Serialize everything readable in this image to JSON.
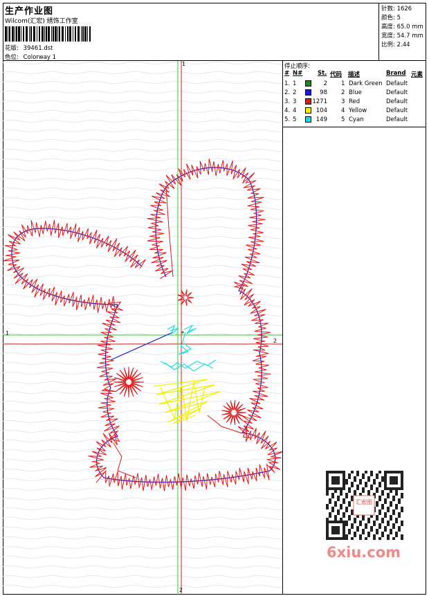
{
  "header": {
    "title": "生产作业图",
    "company": "Wilcom(汇宏) 绣饰工作室",
    "design_label": "花版:",
    "design_value": "39461.dst",
    "colorway_label": "色位:",
    "colorway_value": "Colorway 1"
  },
  "stats": [
    {
      "label": "针数:",
      "value": "1626"
    },
    {
      "label": "颜色:",
      "value": "5"
    },
    {
      "label": "高度:",
      "value": "65.0 mm"
    },
    {
      "label": "宽度:",
      "value": "54.7 mm"
    },
    {
      "label": "比例:",
      "value": "2.44"
    }
  ],
  "legend": {
    "title": "停止顺序:",
    "headers": [
      "#",
      "N#",
      "St.",
      "代码",
      "描述",
      "Brand",
      "元素"
    ],
    "rows": [
      {
        "idx": "1.",
        "n": "1",
        "color": "#1a8a1a",
        "st": "2",
        "code": "1",
        "desc": "Dark Green",
        "brand": "Default"
      },
      {
        "idx": "2.",
        "n": "2",
        "color": "#1a1ad6",
        "st": "98",
        "code": "2",
        "desc": "Blue",
        "brand": "Default"
      },
      {
        "idx": "3.",
        "n": "3",
        "color": "#e01818",
        "st": "1271",
        "code": "3",
        "desc": "Red",
        "brand": "Default"
      },
      {
        "idx": "4.",
        "n": "4",
        "color": "#f0f000",
        "st": "104",
        "code": "4",
        "desc": "Yellow",
        "brand": "Default"
      },
      {
        "idx": "5.",
        "n": "5",
        "color": "#18e0e0",
        "st": "149",
        "code": "5",
        "desc": "Cyan",
        "brand": "Default"
      }
    ]
  },
  "axes": {
    "v_top": "1",
    "h_left": "1",
    "h_right": "2",
    "v_bottom": "2"
  },
  "watermark": {
    "text": "6xiu.com",
    "seal": "汇宏图"
  },
  "colors": {
    "green": "#1a8a1a",
    "blue": "#1a1ad6",
    "red": "#e01818",
    "yellow": "#f0f000",
    "cyan": "#18e0e0",
    "watermark": "#f08a8a"
  }
}
